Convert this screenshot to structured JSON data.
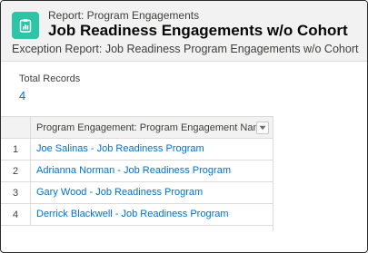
{
  "header": {
    "kicker": "Report: Program Engagements",
    "title": "Job Readiness Engagements w/o Cohort",
    "subtitle": "Exception Report: Job Readiness Program Engagements w/o Cohort",
    "icon": "report-icon",
    "icon_color": "#2ec5a7"
  },
  "summary": {
    "label": "Total Records",
    "value": "4"
  },
  "table": {
    "column": "Program Engagement: Program Engagement Name",
    "rows": [
      {
        "num": "1",
        "name": "Joe Salinas - Job Readiness Program"
      },
      {
        "num": "2",
        "name": "Adrianna Norman - Job Readiness Program"
      },
      {
        "num": "3",
        "name": "Gary Wood - Job Readiness Program"
      },
      {
        "num": "4",
        "name": "Derrick Blackwell - Job Readiness Program"
      }
    ]
  },
  "colors": {
    "link": "#0070d2",
    "header_bg": "#f3f2f2"
  }
}
